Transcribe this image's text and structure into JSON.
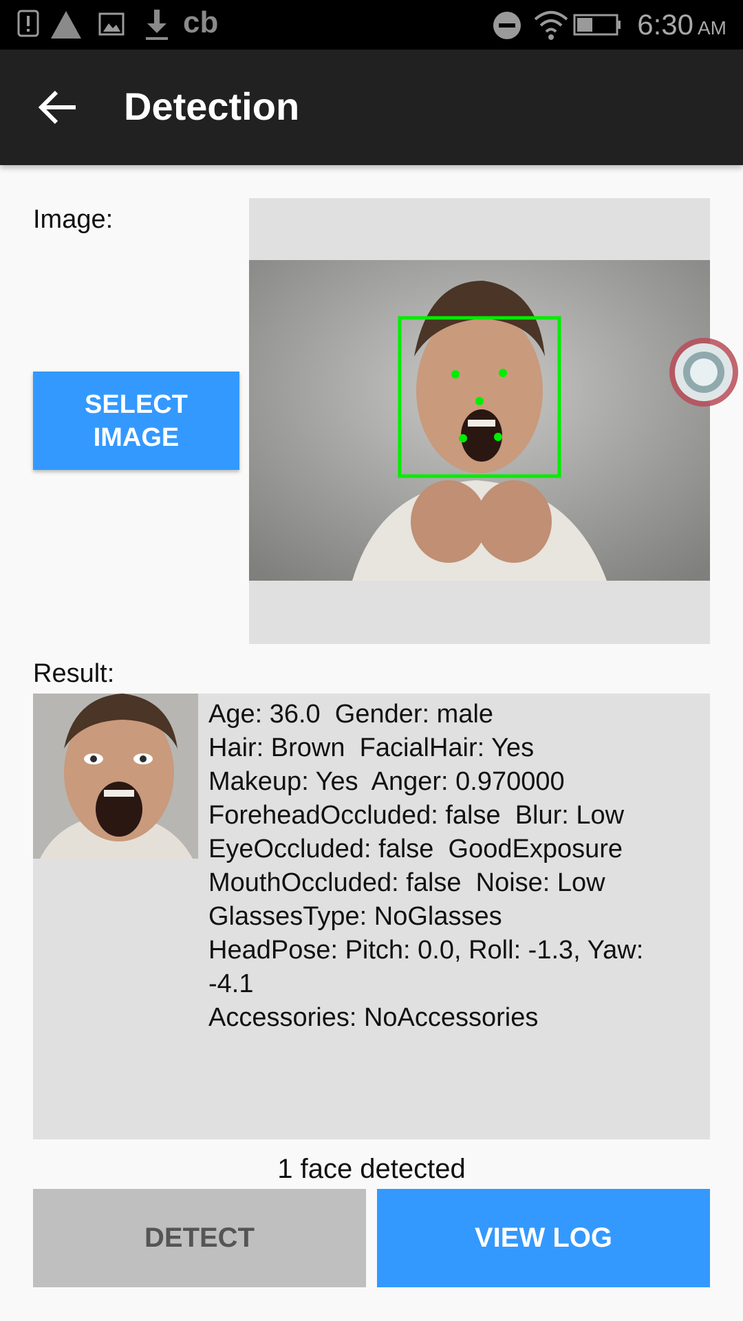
{
  "status_bar": {
    "time": "6:30",
    "ampm": "AM",
    "icons": [
      "alert-icon",
      "warning-triangle-icon",
      "image-icon",
      "download-icon",
      "cb-icon",
      "do-not-disturb-icon",
      "wifi-icon",
      "battery-icon"
    ],
    "cb_label": "cb"
  },
  "app_bar": {
    "title": "Detection",
    "back_icon": "arrow-back-icon"
  },
  "image_section": {
    "label": "Image:",
    "select_button": "SELECT\nIMAGE"
  },
  "result_section": {
    "label": "Result:",
    "lines": [
      "Age: 36.0  Gender: male",
      "Hair: Brown  FacialHair: Yes",
      "Makeup: Yes  Anger: 0.970000",
      "ForeheadOccluded: false  Blur: Low",
      "EyeOccluded: false  GoodExposure",
      "MouthOccluded: false  Noise: Low",
      "GlassesType: NoGlasses",
      "HeadPose: Pitch: 0.0, Roll: -1.3, Yaw:",
      "-4.1",
      "Accessories: NoAccessories"
    ]
  },
  "status": {
    "faces_detected": "1 face detected"
  },
  "buttons": {
    "detect": "DETECT",
    "view_log": "VIEW LOG"
  },
  "colors": {
    "accent": "#3399ff",
    "app_bar": "#212121",
    "disabled_button": "#bfbfbf",
    "face_box": "#00ee00"
  }
}
